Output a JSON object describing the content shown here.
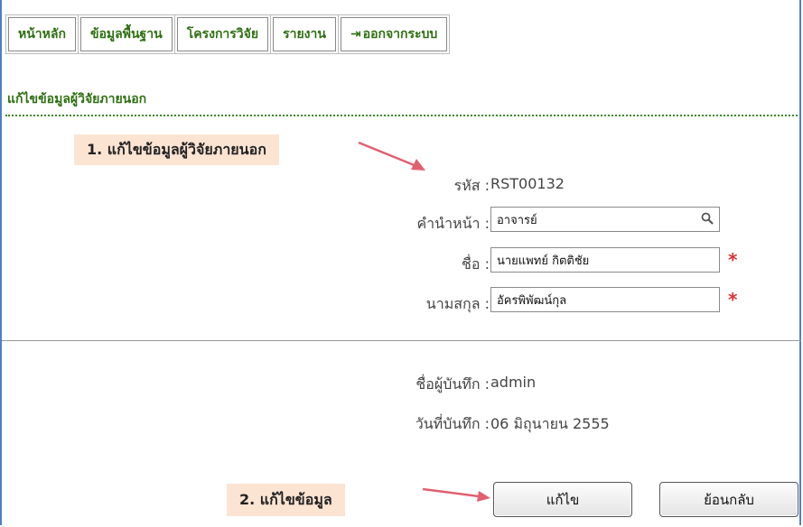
{
  "nav": {
    "home": "หน้าหลัก",
    "basic_data": "ข้อมูลพื้นฐาน",
    "research_projects": "โครงการวิจัย",
    "reports": "รายงาน",
    "logout": "ออกจากระบบ",
    "logout_glyph": "⇥"
  },
  "page_title": "แก้ไขข้อมูลผู้วิจัยภายนอก",
  "callouts": {
    "step1": "1. แก้ไขข้อมูลผู้วิจัยภายนอก",
    "step2": "2. แก้ไขข้อมูล"
  },
  "form": {
    "code_label": "รหัส :",
    "code_value": "RST00132",
    "title_label": "คำนำหน้า :",
    "title_value": "อาจารย์",
    "name_label": "ชื่อ :",
    "name_value": "นายแพทย์ กิตติชัย",
    "surname_label": "นามสกุล :",
    "surname_value": "อัครพิพัฒน์กุล",
    "required_mark": "*"
  },
  "meta": {
    "recorder_label": "ชื่อผู้บันทึก :",
    "recorder_value": "admin",
    "date_label": "วันที่บันทึก :",
    "date_value": "06 มิถุนายน 2555"
  },
  "buttons": {
    "edit": "แก้ไข",
    "back": "ย้อนกลับ"
  },
  "colors": {
    "nav_text": "#2e6f12",
    "callout_bg": "#fce4d3",
    "arrow": "#e06070",
    "required": "#e03030",
    "frame": "#4f7fc4"
  }
}
